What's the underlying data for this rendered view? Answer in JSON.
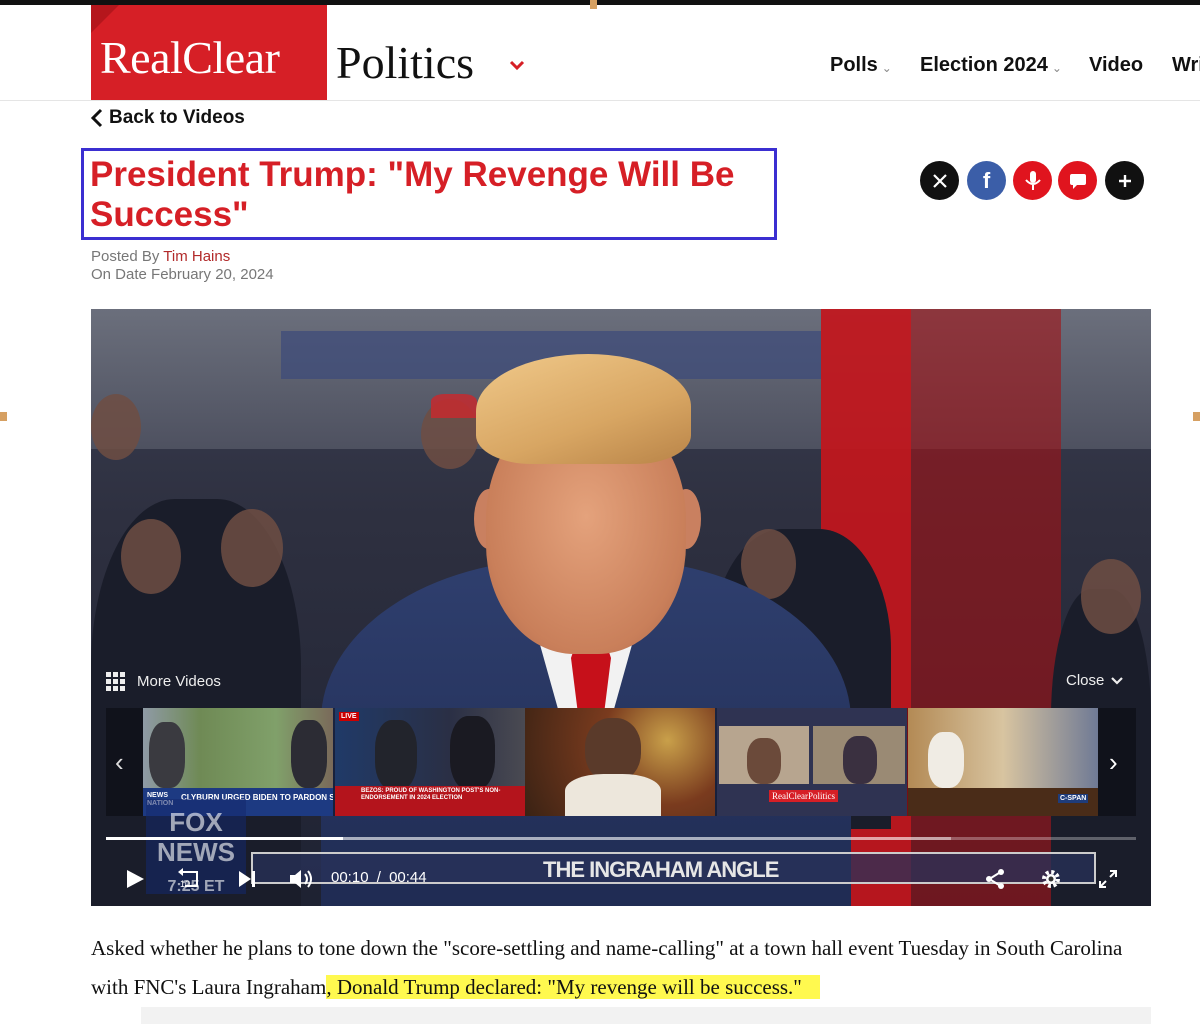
{
  "site": {
    "logo_left": "RealClear",
    "logo_right": "Politics"
  },
  "nav": {
    "items": [
      "Polls",
      "Election 2024",
      "Video",
      "Wri"
    ]
  },
  "back_link": "Back to Videos",
  "article": {
    "title": "President Trump: \"My Revenge Will Be Success\"",
    "posted_by_label": "Posted By",
    "author": "Tim Hains",
    "date": "On Date February 20, 2024",
    "body_plain": "Asked whether he plans to tone down the \"score-settling and name-calling\" at a town hall event Tuesday in South Carolina with FNC's Laura Ingraham",
    "body_highlight": ", Donald Trump declared: \"My revenge will be success.\""
  },
  "social": [
    {
      "name": "x-icon",
      "color": "#111111"
    },
    {
      "name": "facebook-icon",
      "color": "#3b5ea8"
    },
    {
      "name": "truth-social-icon",
      "color": "#e0141e"
    },
    {
      "name": "comment-icon",
      "color": "#e0141e"
    },
    {
      "name": "plus-icon",
      "color": "#111111"
    }
  ],
  "video": {
    "more_videos_label": "More Videos",
    "close_label": "Close",
    "current_time": "00:10",
    "separator": "/",
    "duration": "00:44",
    "progress": 0.23,
    "lower_third": "THE INGRAHAM ANGLE",
    "fox_logo": "FOX NEWS",
    "fox_time": "7:25 ET",
    "skip_seconds": "10",
    "thumbnails": [
      {
        "caption": "CLYBURN URGED BIDEN TO PARDON SON",
        "network": "NEWS NATION",
        "bg": "#5d7d4c"
      },
      {
        "caption": "BEZOS: PROUD OF WASHINGTON POST'S NON-ENDORSEMENT IN 2024 ELECTION",
        "network": "LIVE",
        "bg": "#1c2a4a"
      },
      {
        "caption": "",
        "network": "",
        "bg": "#5a3a22"
      },
      {
        "caption": "RealClearPolitics",
        "network": "",
        "bg": "#2f3352"
      },
      {
        "caption": "",
        "network": "C-SPAN",
        "bg": "#8d6b3c"
      }
    ]
  }
}
